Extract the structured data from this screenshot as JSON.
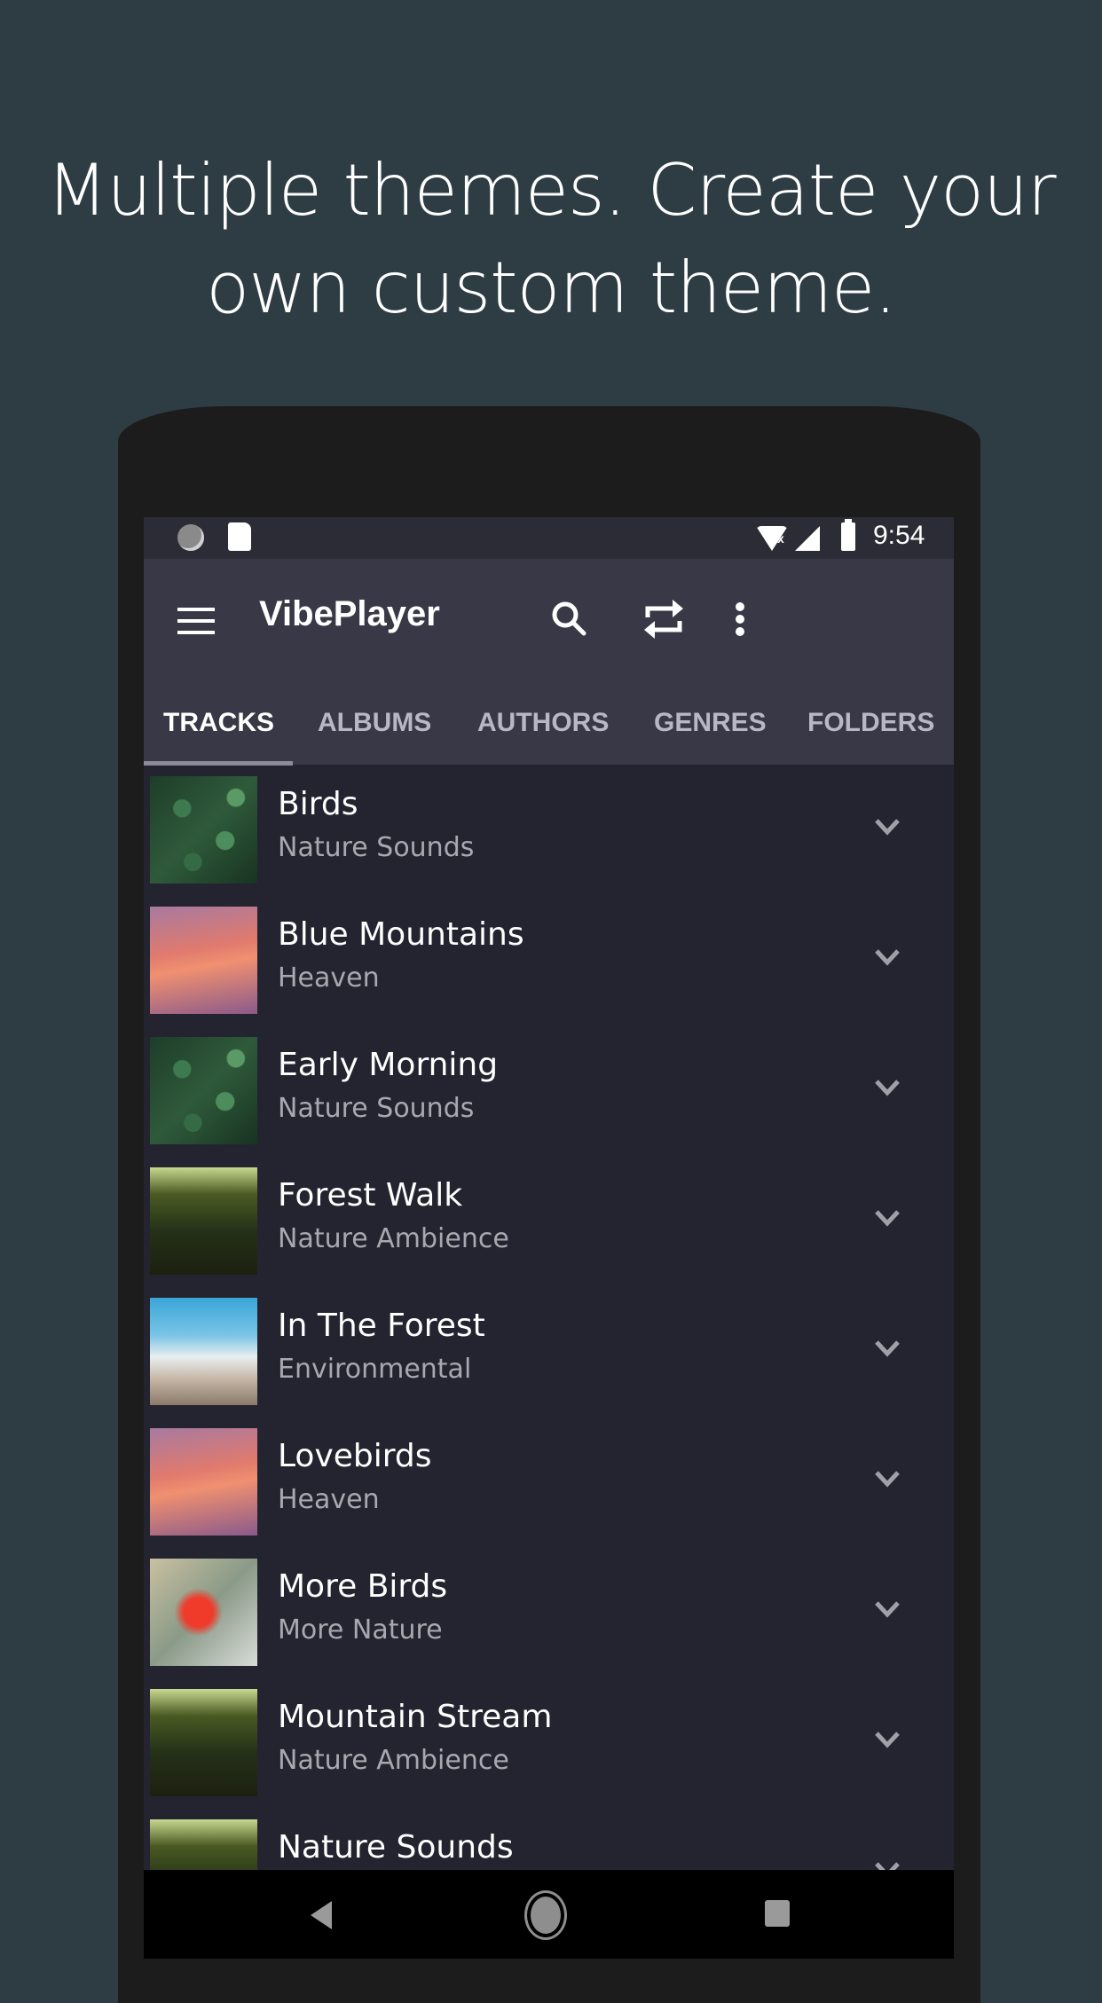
{
  "headline": {
    "line1": "Multiple themes. Create your",
    "line2": "own custom theme."
  },
  "statusbar": {
    "time": "9:54",
    "icons": [
      "sync-icon",
      "sd-card-icon",
      "wifi-off-icon",
      "signal-icon",
      "battery-charging-icon"
    ]
  },
  "toolbar": {
    "title": "VibePlayer",
    "icons": [
      "menu-icon",
      "search-icon",
      "repeat-icon",
      "more-vert-icon"
    ]
  },
  "tabs": [
    {
      "label": "TRACKS",
      "active": true
    },
    {
      "label": "ALBUMS",
      "active": false
    },
    {
      "label": "AUTHORS",
      "active": false
    },
    {
      "label": "GENRES",
      "active": false
    },
    {
      "label": "FOLDERS",
      "active": false
    }
  ],
  "tracks": [
    {
      "title": "Birds",
      "artist": "Nature Sounds",
      "art": "leaves"
    },
    {
      "title": "Blue Mountains",
      "artist": "Heaven",
      "art": "palms"
    },
    {
      "title": "Early Morning",
      "artist": "Nature Sounds",
      "art": "leaves"
    },
    {
      "title": "Forest Walk",
      "artist": "Nature Ambience",
      "art": "forest"
    },
    {
      "title": "In The Forest",
      "artist": "Environmental",
      "art": "beach"
    },
    {
      "title": "Lovebirds",
      "artist": "Heaven",
      "art": "palms"
    },
    {
      "title": "More Birds",
      "artist": "More Nature",
      "art": "flower"
    },
    {
      "title": "Mountain Stream",
      "artist": "Nature Ambience",
      "art": "forest"
    },
    {
      "title": "Nature Sounds",
      "artist": "",
      "art": "forest"
    }
  ],
  "navbar": {
    "icons": [
      "back-icon",
      "home-icon",
      "recents-icon"
    ]
  },
  "colors": {
    "background": "#2e3c43",
    "toolbar": "#383846",
    "list": "#242430",
    "statusbar": "#2c2c36"
  }
}
